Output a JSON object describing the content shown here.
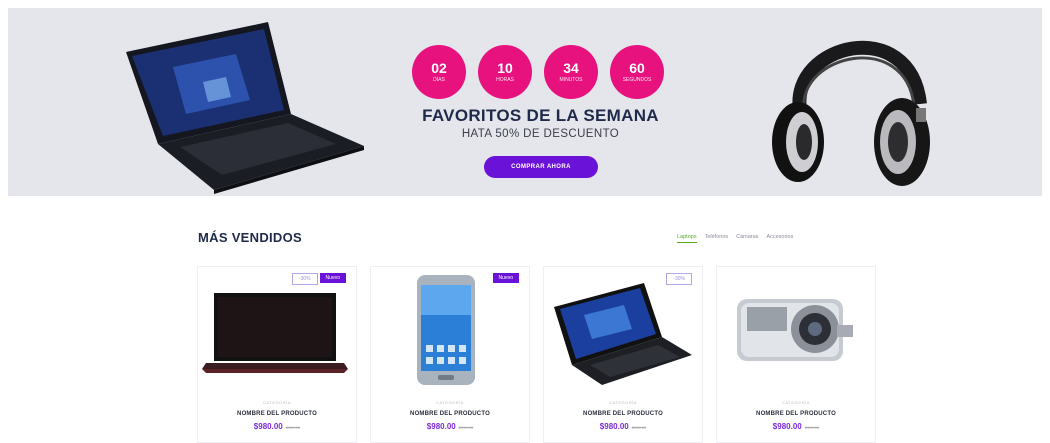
{
  "hero": {
    "timer": [
      {
        "value": "02",
        "unit": "DÍAS"
      },
      {
        "value": "10",
        "unit": "HORAS"
      },
      {
        "value": "34",
        "unit": "MINUTOS"
      },
      {
        "value": "60",
        "unit": "SEGUNDOS"
      }
    ],
    "title": "FAVORITOS DE LA SEMANA",
    "subtitle": "HATA 50% DE DESCUENTO",
    "cta": "COMPRAR AHORA"
  },
  "section": {
    "title": "MÁS VENDIDOS",
    "tabs": [
      "Laptops",
      "Teléfonos",
      "Cámaras",
      "Accesorios"
    ]
  },
  "products": [
    {
      "category": "CATEGORÍA",
      "name": "NOMBRE DEL PRODUCTO",
      "price": "$980.00",
      "old_price": "$990.00",
      "badges": {
        "sale": "-30%",
        "new": "Nuevo"
      }
    },
    {
      "category": "CATEGORÍA",
      "name": "NOMBRE DEL PRODUCTO",
      "price": "$980.00",
      "old_price": "$990.00",
      "badges": {
        "sale": "",
        "new": "Nuevo"
      }
    },
    {
      "category": "CATEGORÍA",
      "name": "NOMBRE DEL PRODUCTO",
      "price": "$980.00",
      "old_price": "$990.00",
      "badges": {
        "sale": "-30%",
        "new": ""
      }
    },
    {
      "category": "CATEGORÍA",
      "name": "NOMBRE DEL PRODUCTO",
      "price": "$980.00",
      "old_price": "$990.00",
      "badges": {
        "sale": "",
        "new": ""
      }
    }
  ],
  "colors": {
    "accent": "#e8127f",
    "brand": "#6a12d8",
    "price": "#7b2bd9",
    "active_tab": "#5aa92c"
  }
}
